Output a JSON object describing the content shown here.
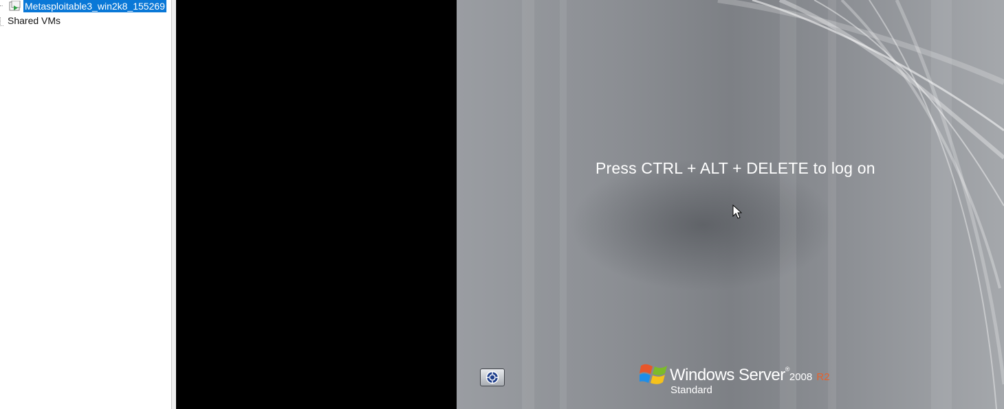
{
  "library": {
    "vm_name": "Metasploitable3_win2k8_155269",
    "shared_label": "Shared VMs"
  },
  "guest": {
    "logon_message": "Press CTRL + ALT + DELETE to log on",
    "brand": {
      "product": "Windows Server",
      "trademark": "®",
      "version": "2008",
      "release": "R2",
      "edition": "Standard"
    },
    "colors": {
      "selection": "#0a78d7",
      "release_accent": "#e8602a"
    },
    "icons": {
      "ease_button": "ease-of-access-icon",
      "logo": "windows-flag-icon",
      "cursor": "mouse-pointer-icon"
    }
  }
}
